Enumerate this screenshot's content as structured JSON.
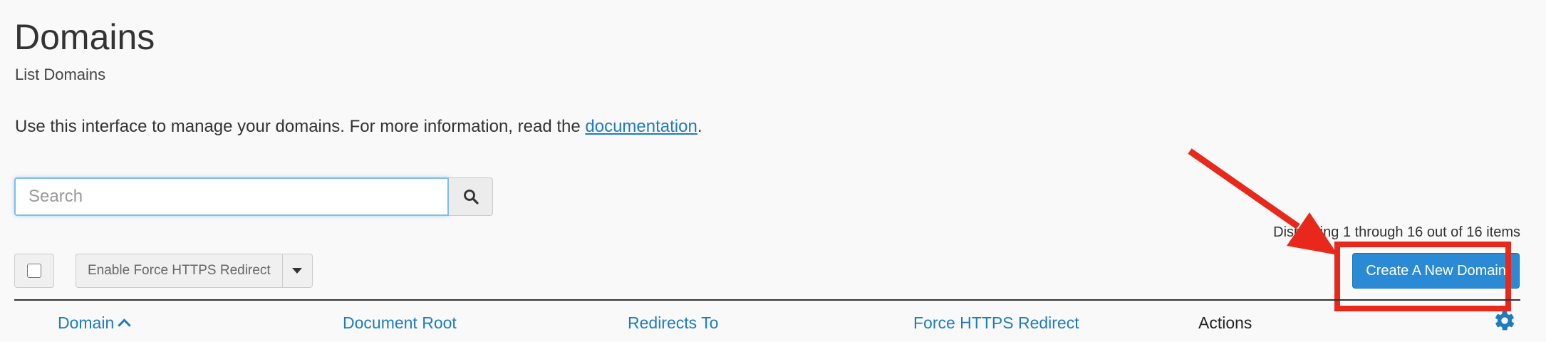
{
  "header": {
    "title": "Domains",
    "subtitle": "List Domains"
  },
  "intro": {
    "text": "Use this interface to manage your domains. For more information, read the ",
    "link_label": "documentation",
    "suffix": "."
  },
  "search": {
    "placeholder": "Search",
    "value": "",
    "button_icon": "search-icon"
  },
  "pagination": {
    "summary": "Displaying 1 through 16 out of 16 items"
  },
  "toolbar": {
    "select_all_checked": false,
    "https_action_label": "Enable Force HTTPS Redirect",
    "https_dropdown_icon": "caret-down-icon",
    "create_label": "Create A New Domain"
  },
  "table": {
    "columns": [
      {
        "label": "Domain",
        "sort": "ascending"
      },
      {
        "label": "Document Root"
      },
      {
        "label": "Redirects To"
      },
      {
        "label": "Force HTTPS Redirect"
      },
      {
        "label": "Actions"
      }
    ],
    "settings_icon": "gear-icon"
  },
  "annotation": {
    "color": "#e8281b",
    "type": "arrow-and-box"
  },
  "colors": {
    "link": "#1f7bc1",
    "primary_button": "#2a8ad6",
    "background": "#f9f9f9"
  }
}
